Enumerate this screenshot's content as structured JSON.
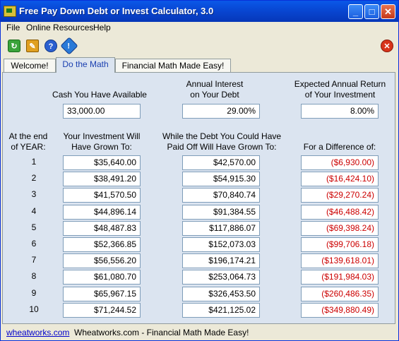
{
  "window": {
    "title": "Free Pay Down Debt or Invest Calculator, 3.0",
    "minimize": "_",
    "maximize": "□",
    "close": "✕"
  },
  "menu": [
    "File",
    "Online Resources",
    "Help"
  ],
  "tabs": [
    "Welcome!",
    "Do the Math",
    "Financial Math Made Easy!"
  ],
  "inputs": {
    "cash_label": "Cash You Have Available",
    "cash_value": "33,000.00",
    "interest_label_1": "Annual Interest",
    "interest_label_2": "on Your Debt",
    "interest_value": "29.00%",
    "return_label_1": "Expected Annual Return",
    "return_label_2": "of Your Investment",
    "return_value": "8.00%"
  },
  "columns": {
    "year_1": "At the end",
    "year_2": "of YEAR:",
    "invest_1": "Your Investment Will",
    "invest_2": "Have Grown To:",
    "debt_1": "While the Debt You Could Have",
    "debt_2": "Paid Off Will Have Grown To:",
    "diff_1": "For a Difference of:"
  },
  "rows": [
    {
      "year": "1",
      "investment": "$35,640.00",
      "debt": "$42,570.00",
      "difference": "($6,930.00)"
    },
    {
      "year": "2",
      "investment": "$38,491.20",
      "debt": "$54,915.30",
      "difference": "($16,424.10)"
    },
    {
      "year": "3",
      "investment": "$41,570.50",
      "debt": "$70,840.74",
      "difference": "($29,270.24)"
    },
    {
      "year": "4",
      "investment": "$44,896.14",
      "debt": "$91,384.55",
      "difference": "($46,488.42)"
    },
    {
      "year": "5",
      "investment": "$48,487.83",
      "debt": "$117,886.07",
      "difference": "($69,398.24)"
    },
    {
      "year": "6",
      "investment": "$52,366.85",
      "debt": "$152,073.03",
      "difference": "($99,706.18)"
    },
    {
      "year": "7",
      "investment": "$56,556.20",
      "debt": "$196,174.21",
      "difference": "($139,618.01)"
    },
    {
      "year": "8",
      "investment": "$61,080.70",
      "debt": "$253,064.73",
      "difference": "($191,984.03)"
    },
    {
      "year": "9",
      "investment": "$65,967.15",
      "debt": "$326,453.50",
      "difference": "($260,486.35)"
    },
    {
      "year": "10",
      "investment": "$71,244.52",
      "debt": "$421,125.02",
      "difference": "($349,880.49)"
    }
  ],
  "status": {
    "link": "wheatworks.com",
    "text": "Wheatworks.com - Financial Math Made Easy!"
  },
  "colors": {
    "title_bar": "#0845d0",
    "negative": "#cc0000",
    "panel": "#dbe4f0"
  }
}
